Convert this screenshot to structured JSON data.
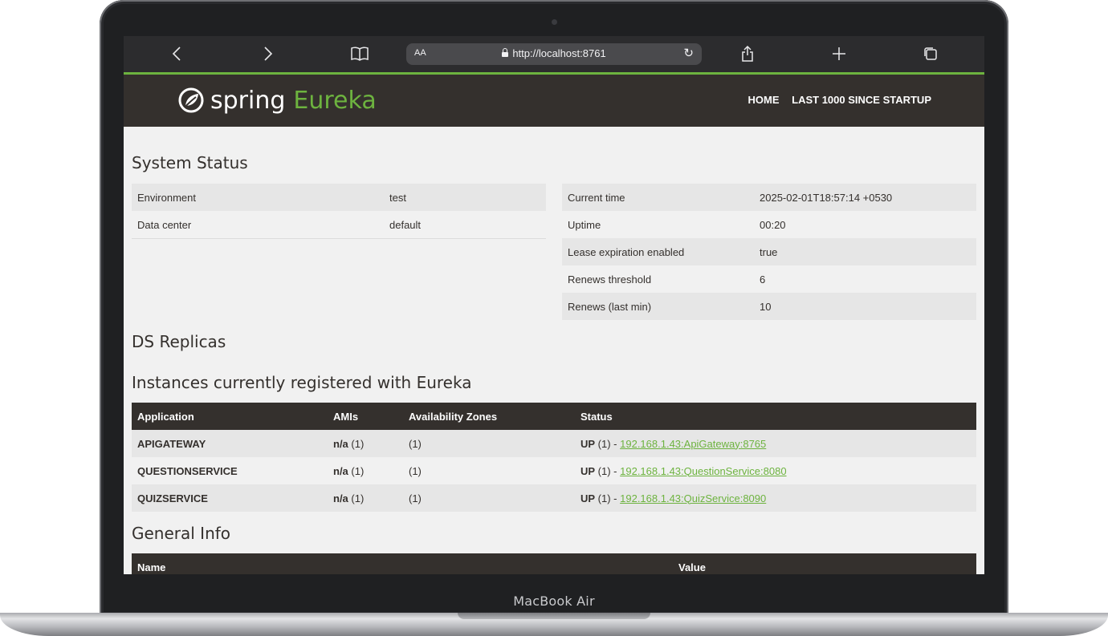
{
  "device": {
    "label": "MacBook Air"
  },
  "browser": {
    "text_size_label": "AA",
    "url": "http://localhost:8761"
  },
  "brand": {
    "spring": "spring",
    "eureka": "Eureka"
  },
  "nav": {
    "home": "HOME",
    "last1000": "LAST 1000 SINCE STARTUP"
  },
  "accent_color": "#6db33f",
  "header_color": "#34302d",
  "system_status": {
    "title": "System Status",
    "left": [
      {
        "key": "Environment",
        "value": "test"
      },
      {
        "key": "Data center",
        "value": "default"
      }
    ],
    "right": [
      {
        "key": "Current time",
        "value": "2025-02-01T18:57:14 +0530"
      },
      {
        "key": "Uptime",
        "value": "00:20"
      },
      {
        "key": "Lease expiration enabled",
        "value": "true"
      },
      {
        "key": "Renews threshold",
        "value": "6"
      },
      {
        "key": "Renews (last min)",
        "value": "10"
      }
    ]
  },
  "ds_replicas": {
    "title": "DS Replicas"
  },
  "instances": {
    "title": "Instances currently registered with Eureka",
    "headers": [
      "Application",
      "AMIs",
      "Availability Zones",
      "Status"
    ],
    "rows": [
      {
        "app": "APIGATEWAY",
        "ami_bold": "n/a",
        "ami_count": " (1)",
        "zones": "(1)",
        "status_bold": "UP",
        "status_count": " (1) - ",
        "link": "192.168.1.43:ApiGateway:8765"
      },
      {
        "app": "QUESTIONSERVICE",
        "ami_bold": "n/a",
        "ami_count": " (1)",
        "zones": "(1)",
        "status_bold": "UP",
        "status_count": " (1) - ",
        "link": "192.168.1.43:QuestionService:8080"
      },
      {
        "app": "QUIZSERVICE",
        "ami_bold": "n/a",
        "ami_count": " (1)",
        "zones": "(1)",
        "status_bold": "UP",
        "status_count": " (1) - ",
        "link": "192.168.1.43:QuizService:8090"
      }
    ]
  },
  "general_info": {
    "title": "General Info",
    "headers": [
      "Name",
      "Value"
    ]
  }
}
